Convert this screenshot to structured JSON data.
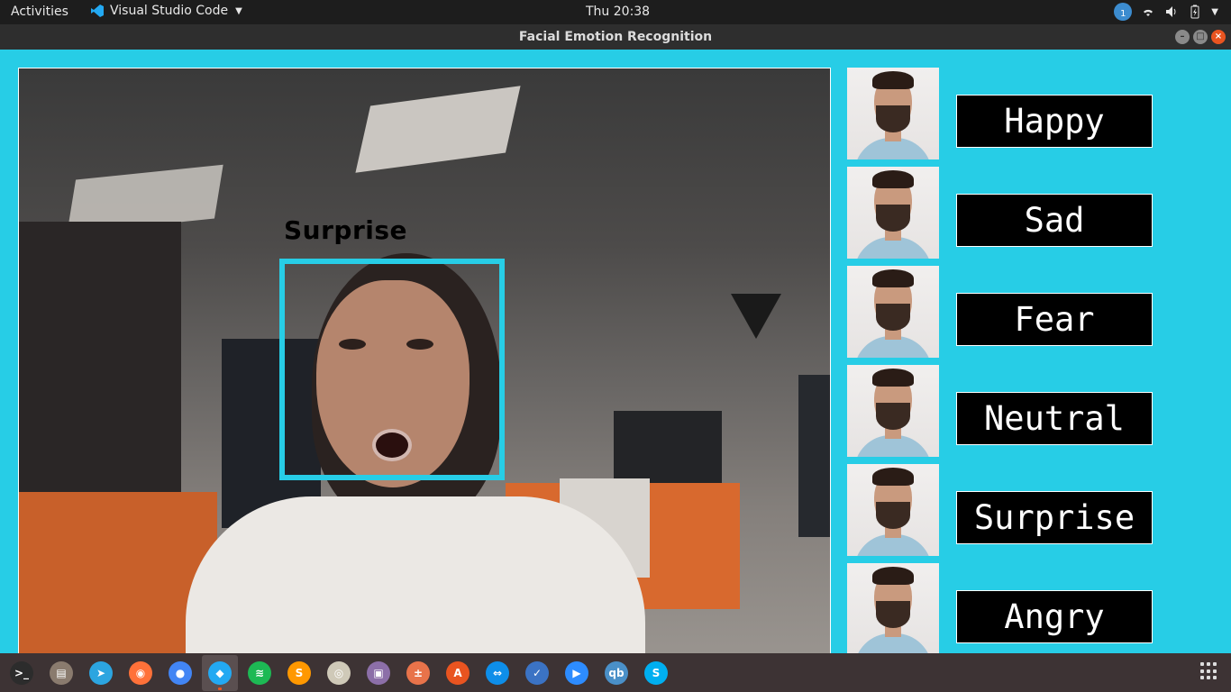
{
  "top_panel": {
    "activities": "Activities",
    "app_name": "Visual Studio Code",
    "clock": "Thu 20:38",
    "notification_count": "1"
  },
  "window": {
    "title": "Facial Emotion Recognition",
    "controls": [
      "minimize-icon",
      "maximize-icon",
      "close-icon"
    ]
  },
  "camera": {
    "detected_label": "Surprise",
    "box_color": "#27cde6"
  },
  "emotions": [
    {
      "label": "Happy"
    },
    {
      "label": "Sad"
    },
    {
      "label": "Fear"
    },
    {
      "label": "Neutral"
    },
    {
      "label": "Surprise"
    },
    {
      "label": "Angry"
    }
  ],
  "dock": {
    "items": [
      {
        "name": "terminal-icon",
        "glyph": ">_",
        "color": "#2c2c2c"
      },
      {
        "name": "files-icon",
        "glyph": "▤",
        "color": "#8a7b6e"
      },
      {
        "name": "telegram-icon",
        "glyph": "➤",
        "color": "#2ca5e0"
      },
      {
        "name": "firefox-icon",
        "glyph": "◉",
        "color": "#ff7139"
      },
      {
        "name": "chrome-icon",
        "glyph": "●",
        "color": "#4285f4"
      },
      {
        "name": "vscode-icon",
        "glyph": "◆",
        "color": "#23a9f2",
        "active": true
      },
      {
        "name": "spotify-icon",
        "glyph": "≋",
        "color": "#1db954"
      },
      {
        "name": "sublime-icon",
        "glyph": "S",
        "color": "#ff9800"
      },
      {
        "name": "media-player-icon",
        "glyph": "◎",
        "color": "#cfc9b8"
      },
      {
        "name": "screenshot-icon",
        "glyph": "▣",
        "color": "#8c6fa8"
      },
      {
        "name": "calculator-icon",
        "glyph": "±",
        "color": "#e8734a"
      },
      {
        "name": "software-center-icon",
        "glyph": "A",
        "color": "#e95420"
      },
      {
        "name": "teamviewer-icon",
        "glyph": "⇔",
        "color": "#0e8ee9"
      },
      {
        "name": "tasks-icon",
        "glyph": "✓",
        "color": "#3b73c4"
      },
      {
        "name": "zoom-icon",
        "glyph": "▶",
        "color": "#2d8cff"
      },
      {
        "name": "qbittorrent-icon",
        "glyph": "qb",
        "color": "#4a90c8"
      },
      {
        "name": "skype-icon",
        "glyph": "S",
        "color": "#00aff0"
      }
    ]
  }
}
